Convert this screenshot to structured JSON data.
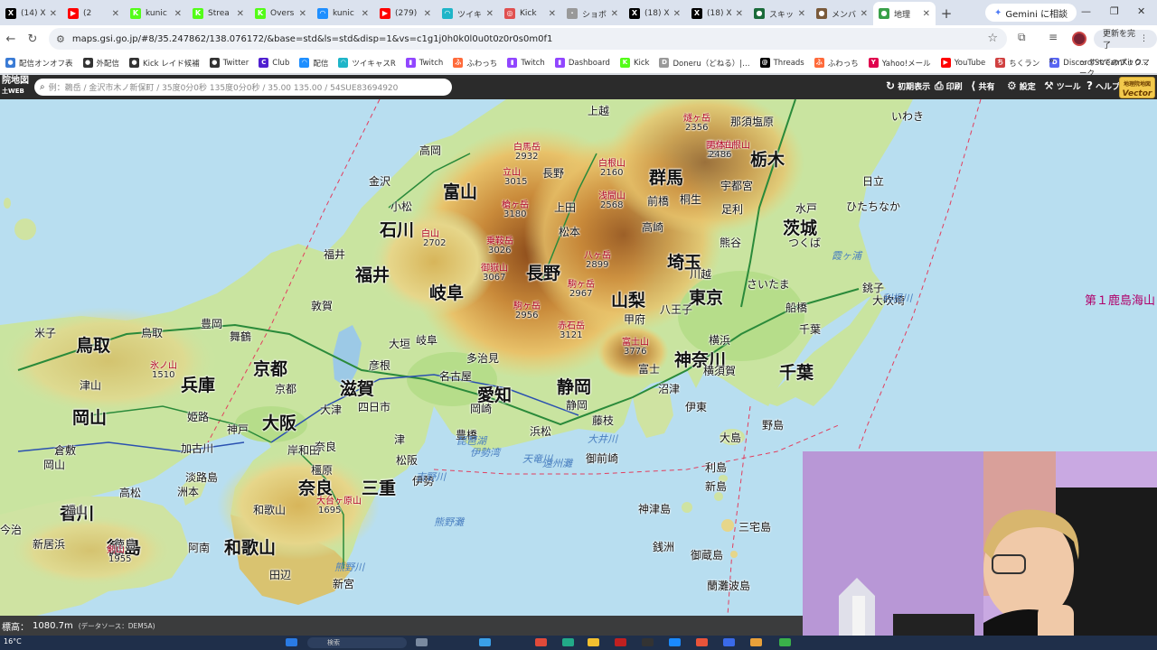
{
  "browser": {
    "tabs": [
      {
        "label": "(14) X",
        "color": "#000000",
        "glyph": "X"
      },
      {
        "label": "(2",
        "color": "#ff0000",
        "glyph": "▶"
      },
      {
        "label": "kunic",
        "color": "#53fc18",
        "glyph": "K"
      },
      {
        "label": "Strea",
        "color": "#53fc18",
        "glyph": "K"
      },
      {
        "label": "Overs",
        "color": "#53fc18",
        "glyph": "K"
      },
      {
        "label": "kunic",
        "color": "#1f8fff",
        "glyph": "◠"
      },
      {
        "label": "(279)",
        "color": "#ff0000",
        "glyph": "▶"
      },
      {
        "label": "ツイキ",
        "color": "#1fb5c8",
        "glyph": "◠"
      },
      {
        "label": "Kick",
        "color": "#e05050",
        "glyph": "◎"
      },
      {
        "label": "ショボ",
        "color": "#999999",
        "glyph": "·"
      },
      {
        "label": "(18) X",
        "color": "#000000",
        "glyph": "X"
      },
      {
        "label": "(18) X",
        "color": "#000000",
        "glyph": "X"
      },
      {
        "label": "スキッ",
        "color": "#1a6b3a",
        "glyph": "●"
      },
      {
        "label": "メンバ",
        "color": "#7a5a3a",
        "glyph": "●"
      },
      {
        "label": "地理",
        "color": "#3aa04a",
        "glyph": "●",
        "active": true
      }
    ],
    "new_tab": "+",
    "gemini": "Gemini に相談",
    "url": "maps.gsi.go.jp/#8/35.247862/138.076172/&base=std&ls=std&disp=1&vs=c1g1j0h0k0l0u0t0z0r0s0m0f1",
    "update_button": "更新を完了",
    "bookmarks": [
      {
        "label": "配信オンオフ表",
        "color": "#3a7bd5",
        "glyph": "●"
      },
      {
        "label": "外配信",
        "color": "#333333",
        "glyph": "●"
      },
      {
        "label": "Kick レイド候補",
        "color": "#333333",
        "glyph": "●"
      },
      {
        "label": "Twitter",
        "color": "#333333",
        "glyph": "●"
      },
      {
        "label": "Club",
        "color": "#5020d0",
        "glyph": "C"
      },
      {
        "label": "配信",
        "color": "#1f8fff",
        "glyph": "◠"
      },
      {
        "label": "ツイキャスR",
        "color": "#1fb5c8",
        "glyph": "◠"
      },
      {
        "label": "Twitch",
        "color": "#9146ff",
        "glyph": "▮"
      },
      {
        "label": "ふわっち",
        "color": "#ff6a3a",
        "glyph": "ふ"
      },
      {
        "label": "Twitch",
        "color": "#9146ff",
        "glyph": "▮"
      },
      {
        "label": "Dashboard",
        "color": "#9146ff",
        "glyph": "▮"
      },
      {
        "label": "Kick",
        "color": "#53fc18",
        "glyph": "K"
      },
      {
        "label": "Doneru（どねる）|…",
        "color": "#999999",
        "glyph": "D"
      },
      {
        "label": "Threads",
        "color": "#000000",
        "glyph": "@"
      },
      {
        "label": "ふわっち",
        "color": "#ff6a3a",
        "glyph": "ふ"
      },
      {
        "label": "Yahoo!メール",
        "color": "#e0004d",
        "glyph": "Y"
      },
      {
        "label": "YouTube",
        "color": "#ff0000",
        "glyph": "▶"
      },
      {
        "label": "ちくラン",
        "color": "#d04040",
        "glyph": "ち"
      },
      {
        "label": "Discord StreamKit O…",
        "color": "#5865f2",
        "glyph": "D"
      }
    ],
    "bookmarks_more": "»",
    "all_bookmarks": "すべてのブックマーク"
  },
  "gsi": {
    "logo": "院地図",
    "logo_sub": "土WEB",
    "search_placeholder": "例：鵜岳 / 金沢市木ノ新保町 / 35度0分0秒 135度0分0秒 / 35.00 135.00 / 54SUE83694920",
    "menu": [
      {
        "icon": "↻",
        "label": "初期表示"
      },
      {
        "icon": "⎙",
        "label": "印刷"
      },
      {
        "icon": "⟨",
        "label": "共有"
      },
      {
        "icon": "⚙",
        "label": "設定"
      },
      {
        "icon": "⚒",
        "label": "ツール"
      },
      {
        "icon": "?",
        "label": "ヘルプ"
      }
    ],
    "vector_badge_top": "地理院地図",
    "vector_badge": "Vector"
  },
  "map": {
    "prefectures": [
      "富山",
      "石川",
      "福井",
      "岐阜",
      "長野",
      "群馬",
      "栃木",
      "茨城",
      "埼玉",
      "東京",
      "千葉",
      "神奈川",
      "山梨",
      "静岡",
      "愛知",
      "三重",
      "滋賀",
      "京都",
      "大阪",
      "兵庫",
      "奈良",
      "和歌山",
      "鳥取",
      "岡山",
      "香川",
      "徳島"
    ],
    "cities": [
      "上越",
      "長野",
      "高岡",
      "金沢",
      "小松",
      "福井",
      "敦賀",
      "舞鶴",
      "豊岡",
      "鳥取",
      "米子",
      "津山",
      "姫路",
      "神戸",
      "加古川",
      "京都",
      "大津",
      "彦根",
      "大垣",
      "岐阜",
      "多治見",
      "名古屋",
      "四日市",
      "津",
      "松阪",
      "伊勢",
      "岡崎",
      "豊橋",
      "浜松",
      "静岡",
      "藤枝",
      "沼津",
      "富士",
      "甲府",
      "松本",
      "上田",
      "高崎",
      "前橋",
      "桐生",
      "宇都宮",
      "足利",
      "熊谷",
      "日立",
      "ひたちなか",
      "いわき",
      "那須塩原",
      "水戸",
      "つくば",
      "さいたま",
      "川越",
      "八王子",
      "船橋",
      "千葉",
      "横浜",
      "横須賀",
      "銚子",
      "田辺",
      "新宮",
      "阿南",
      "徳島",
      "高松",
      "倉敷",
      "岡山",
      "福山",
      "今治",
      "新居浜",
      "洲本",
      "淡路島",
      "岸和田",
      "和歌山",
      "奈良",
      "橿原",
      "伊東",
      "大島",
      "利島",
      "新島",
      "神津島",
      "三宅島",
      "御蔵島",
      "銭洲",
      "御前崎",
      "蘭灘波島",
      "野島",
      "大吹埼"
    ],
    "peaks": [
      {
        "name": "白馬岳",
        "elev": "2932"
      },
      {
        "name": "立山",
        "elev": "3015"
      },
      {
        "name": "槍ヶ岳",
        "elev": "3180"
      },
      {
        "name": "乗鞍岳",
        "elev": "3026"
      },
      {
        "name": "御嶽山",
        "elev": "3067"
      },
      {
        "name": "駒ヶ岳",
        "elev": "2956"
      },
      {
        "name": "赤石岳",
        "elev": "3121"
      },
      {
        "name": "富士山",
        "elev": "3776"
      },
      {
        "name": "八ヶ岳",
        "elev": "2899"
      },
      {
        "name": "浅間山",
        "elev": "2568"
      },
      {
        "name": "白根山",
        "elev": "2160"
      },
      {
        "name": "日光白根山",
        "elev": "2578"
      },
      {
        "name": "男体山",
        "elev": "2486"
      },
      {
        "name": "燧ヶ岳",
        "elev": "2356"
      },
      {
        "name": "白山",
        "elev": "2702"
      },
      {
        "name": "氷ノ山",
        "elev": "1510"
      },
      {
        "name": "大台ヶ原山",
        "elev": "1695"
      },
      {
        "name": "剣山",
        "elev": "1955"
      },
      {
        "name": "駒ヶ岳",
        "elev": "2967"
      }
    ],
    "seas": [
      "第１鹿島海山",
      "霞ヶ浦",
      "利根川",
      "天竜川",
      "大井川",
      "熊野川",
      "吉野川",
      "琵琶湖",
      "伊勢湾",
      "遠州灘",
      "熊野灘"
    ]
  },
  "status": {
    "elevation": "1080.7m",
    "source": "(データソース：DEM5A)",
    "weather": "16°C"
  },
  "taskbar": {
    "search": "検索"
  }
}
